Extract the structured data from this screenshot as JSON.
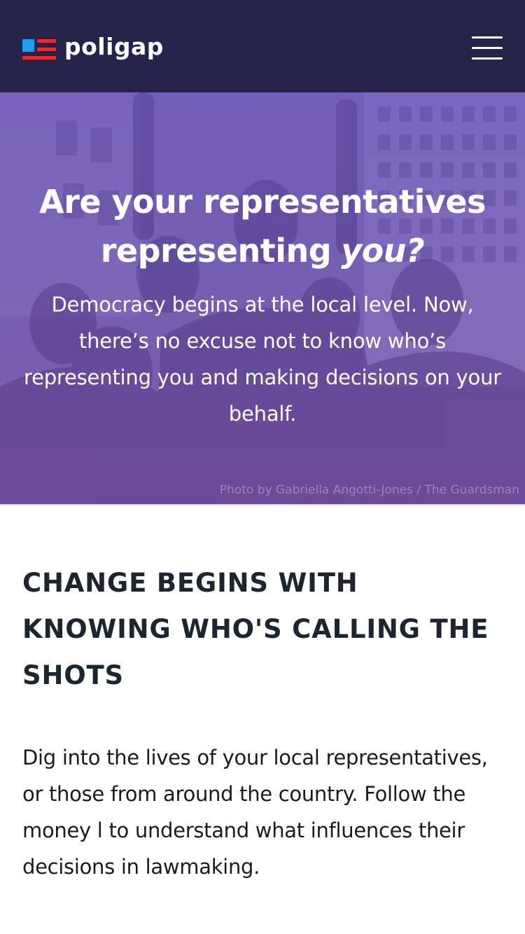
{
  "header": {
    "brand": "poligap",
    "menu_icon": "hamburger-menu-icon",
    "colors": {
      "background": "#26234a",
      "logo_blue": "#1e9ff0",
      "logo_red": "#ee2a2e"
    }
  },
  "hero": {
    "title_line1": "Are your representatives",
    "title_line2_prefix": "representing",
    "title_line2_emphasis": "you?",
    "subtitle": "Democracy begins at the local level. Now, there’s no excuse not to know who’s representing you and making decisions on your behalf.",
    "photo_credit": "Photo by Gabriella Angotti-Jones / The Guardsman",
    "overlay_color": "#6a4fa6"
  },
  "section": {
    "heading": "CHANGE BEGINS WITH KNOWING WHO'S CALLING THE SHOTS",
    "body": "Dig into the lives of your local representatives, or those from around the country. Follow the money l to understand what influences their decisions in lawmaking."
  }
}
